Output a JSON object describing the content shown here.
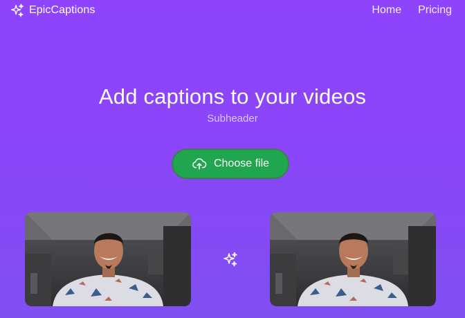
{
  "nav": {
    "brand": "EpicCaptions",
    "brand_icon": "sparkles-icon",
    "links": [
      "Home",
      "Pricing"
    ]
  },
  "hero": {
    "title": "Add captions to your videos",
    "subtitle": "Subheader"
  },
  "upload": {
    "button_label": "Choose file",
    "button_icon": "cloud-upload-icon"
  },
  "previews": {
    "left": "video-thumbnail-original",
    "right": "video-thumbnail-captioned",
    "divider_icon": "sparkles-icon"
  },
  "colors": {
    "background": "#8f44fb",
    "button": "#1fa64f",
    "subtitle": "#ddc9fd"
  }
}
